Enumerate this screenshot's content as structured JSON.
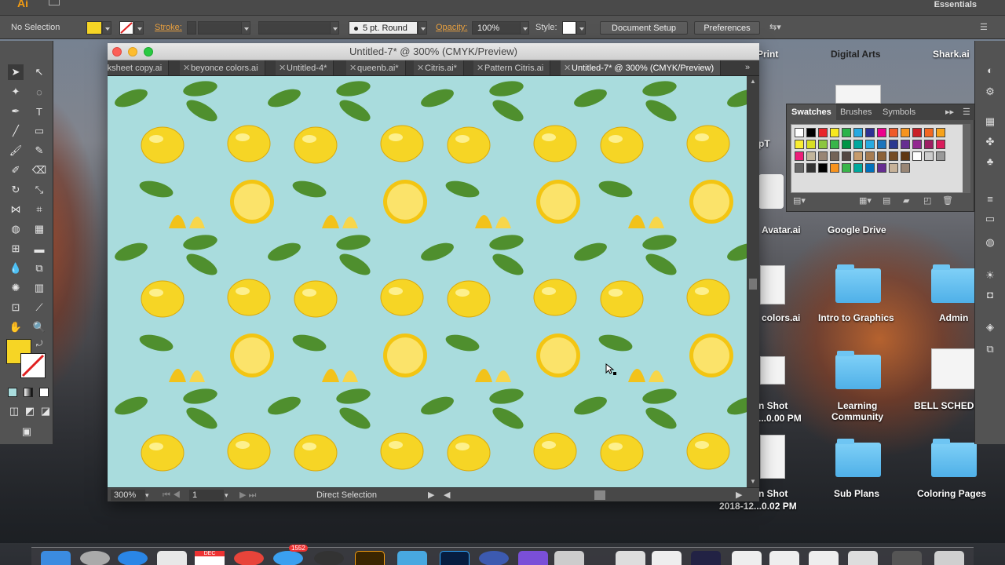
{
  "app": {
    "logo": "Ai",
    "workspace": "Essentials"
  },
  "control_bar": {
    "selection": "No Selection",
    "stroke_label": "Stroke:",
    "brush_profile": "5 pt. Round",
    "opacity_label": "Opacity:",
    "opacity_value": "100%",
    "style_label": "Style:",
    "document_setup": "Document Setup",
    "preferences": "Preferences"
  },
  "document": {
    "window_title": "Untitled-7* @ 300% (CMYK/Preview)",
    "tabs": [
      {
        "label": "rksheet copy.ai"
      },
      {
        "label": "beyonce colors.ai"
      },
      {
        "label": "Untitled-4*"
      },
      {
        "label": "queenb.ai*"
      },
      {
        "label": "Citris.ai*"
      },
      {
        "label": "Pattern Citris.ai"
      },
      {
        "label": "Untitled-7* @ 300% (CMYK/Preview)",
        "active": true
      }
    ],
    "zoom": "300%",
    "page": "1",
    "status_tool": "Direct Selection",
    "canvas_color": "#a9dcdd"
  },
  "swatches_panel": {
    "tabs": [
      "Swatches",
      "Brushes",
      "Symbols"
    ],
    "active_tab": "Swatches",
    "row1": [
      "#ffffff",
      "#000000",
      "#e8262a",
      "#f7e81f",
      "#2bb34a",
      "#27a9e1",
      "#2e3192",
      "#ec008c",
      "#f05a28",
      "#f7941d",
      "#c92127",
      "#f26722",
      "#f6a21b"
    ],
    "row2": [
      "#f9ed32",
      "#d7df23",
      "#8cc63f",
      "#39b54a",
      "#009444",
      "#00a79d",
      "#27aae1",
      "#1c75bc",
      "#2b3990",
      "#662d91",
      "#92278f",
      "#9e1f63",
      "#da1c5c"
    ],
    "row3": [
      "#ed1e79",
      "#c2b59b",
      "#998675",
      "#736357",
      "#534741",
      "#c69c6d",
      "#a67c52",
      "#8c6239",
      "#754c24",
      "#603813",
      "#ffffff",
      "#cccccc",
      "#999999"
    ],
    "row4": [
      "#666666",
      "#333333",
      "#000000",
      "#f7931e",
      "#39b54a",
      "#00a99d",
      "#0071bc",
      "#662d91",
      "#c7b299",
      "#998675"
    ]
  },
  "desktop": {
    "items": [
      {
        "label": "Print"
      },
      {
        "label": "Digital Arts"
      },
      {
        "label": "Shark.ai"
      },
      {
        "label": "Avatar.ai"
      },
      {
        "label": "Google Drive"
      },
      {
        "label": "colors.ai"
      },
      {
        "label": "Intro to Graphics"
      },
      {
        "label": "Admin"
      },
      {
        "label": "n Shot"
      },
      {
        "label": "...0.00 PM"
      },
      {
        "label": "Learning Community"
      },
      {
        "label": "BELL SCHEDULE"
      },
      {
        "label": "n Shot"
      },
      {
        "label": "2018-12...0.02 PM"
      },
      {
        "label": "Sub Plans"
      },
      {
        "label": "Coloring Pages"
      },
      {
        "label": "pT"
      }
    ]
  },
  "dock": {
    "badge": "1552",
    "calendar_month": "DEC"
  },
  "colors": {
    "ui_panel": "#535353",
    "accent_orange": "#e8a040",
    "lemon_yellow": "#f6d525",
    "leaf_green": "#4f8f2e"
  }
}
